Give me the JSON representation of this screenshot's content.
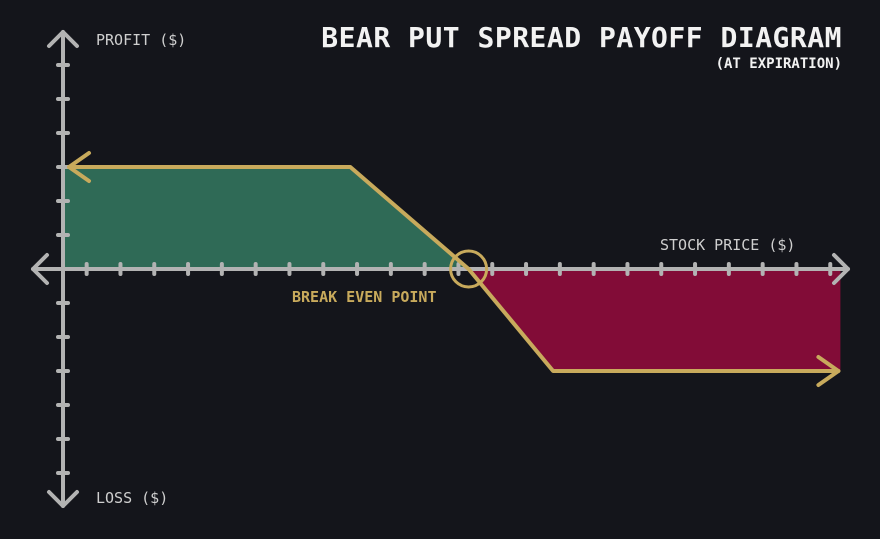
{
  "chart_data": {
    "type": "line",
    "title": "BEAR PUT SPREAD PAYOFF DIAGRAM",
    "subtitle": "(AT EXPIRATION)",
    "ylabel_positive": "PROFIT ($)",
    "ylabel_negative": "LOSS ($)",
    "xlabel": "STOCK PRICE ($)",
    "annotation": "BREAK EVEN POINT",
    "x_ticks_count": 23,
    "y_ticks_count": 13,
    "series": [
      {
        "x": [
          0,
          8.5,
          12,
          14.5,
          23
        ],
        "y": [
          3,
          3,
          0,
          -3,
          -3
        ]
      }
    ],
    "break_even": {
      "x": 12,
      "y": 0
    },
    "max_profit": 3,
    "max_loss": -3,
    "xlim": [
      -1,
      23
    ],
    "ylim": [
      -7,
      7
    ],
    "grid": false,
    "legend": "none",
    "colors": {
      "background": "#14151b",
      "axis": "#b3b3b3",
      "payoff_line": "#c8aa5c",
      "profit_fill": "#2f6a56",
      "loss_fill": "#820c37",
      "text": "#cfcfcf",
      "title": "#f2f2f2"
    }
  }
}
